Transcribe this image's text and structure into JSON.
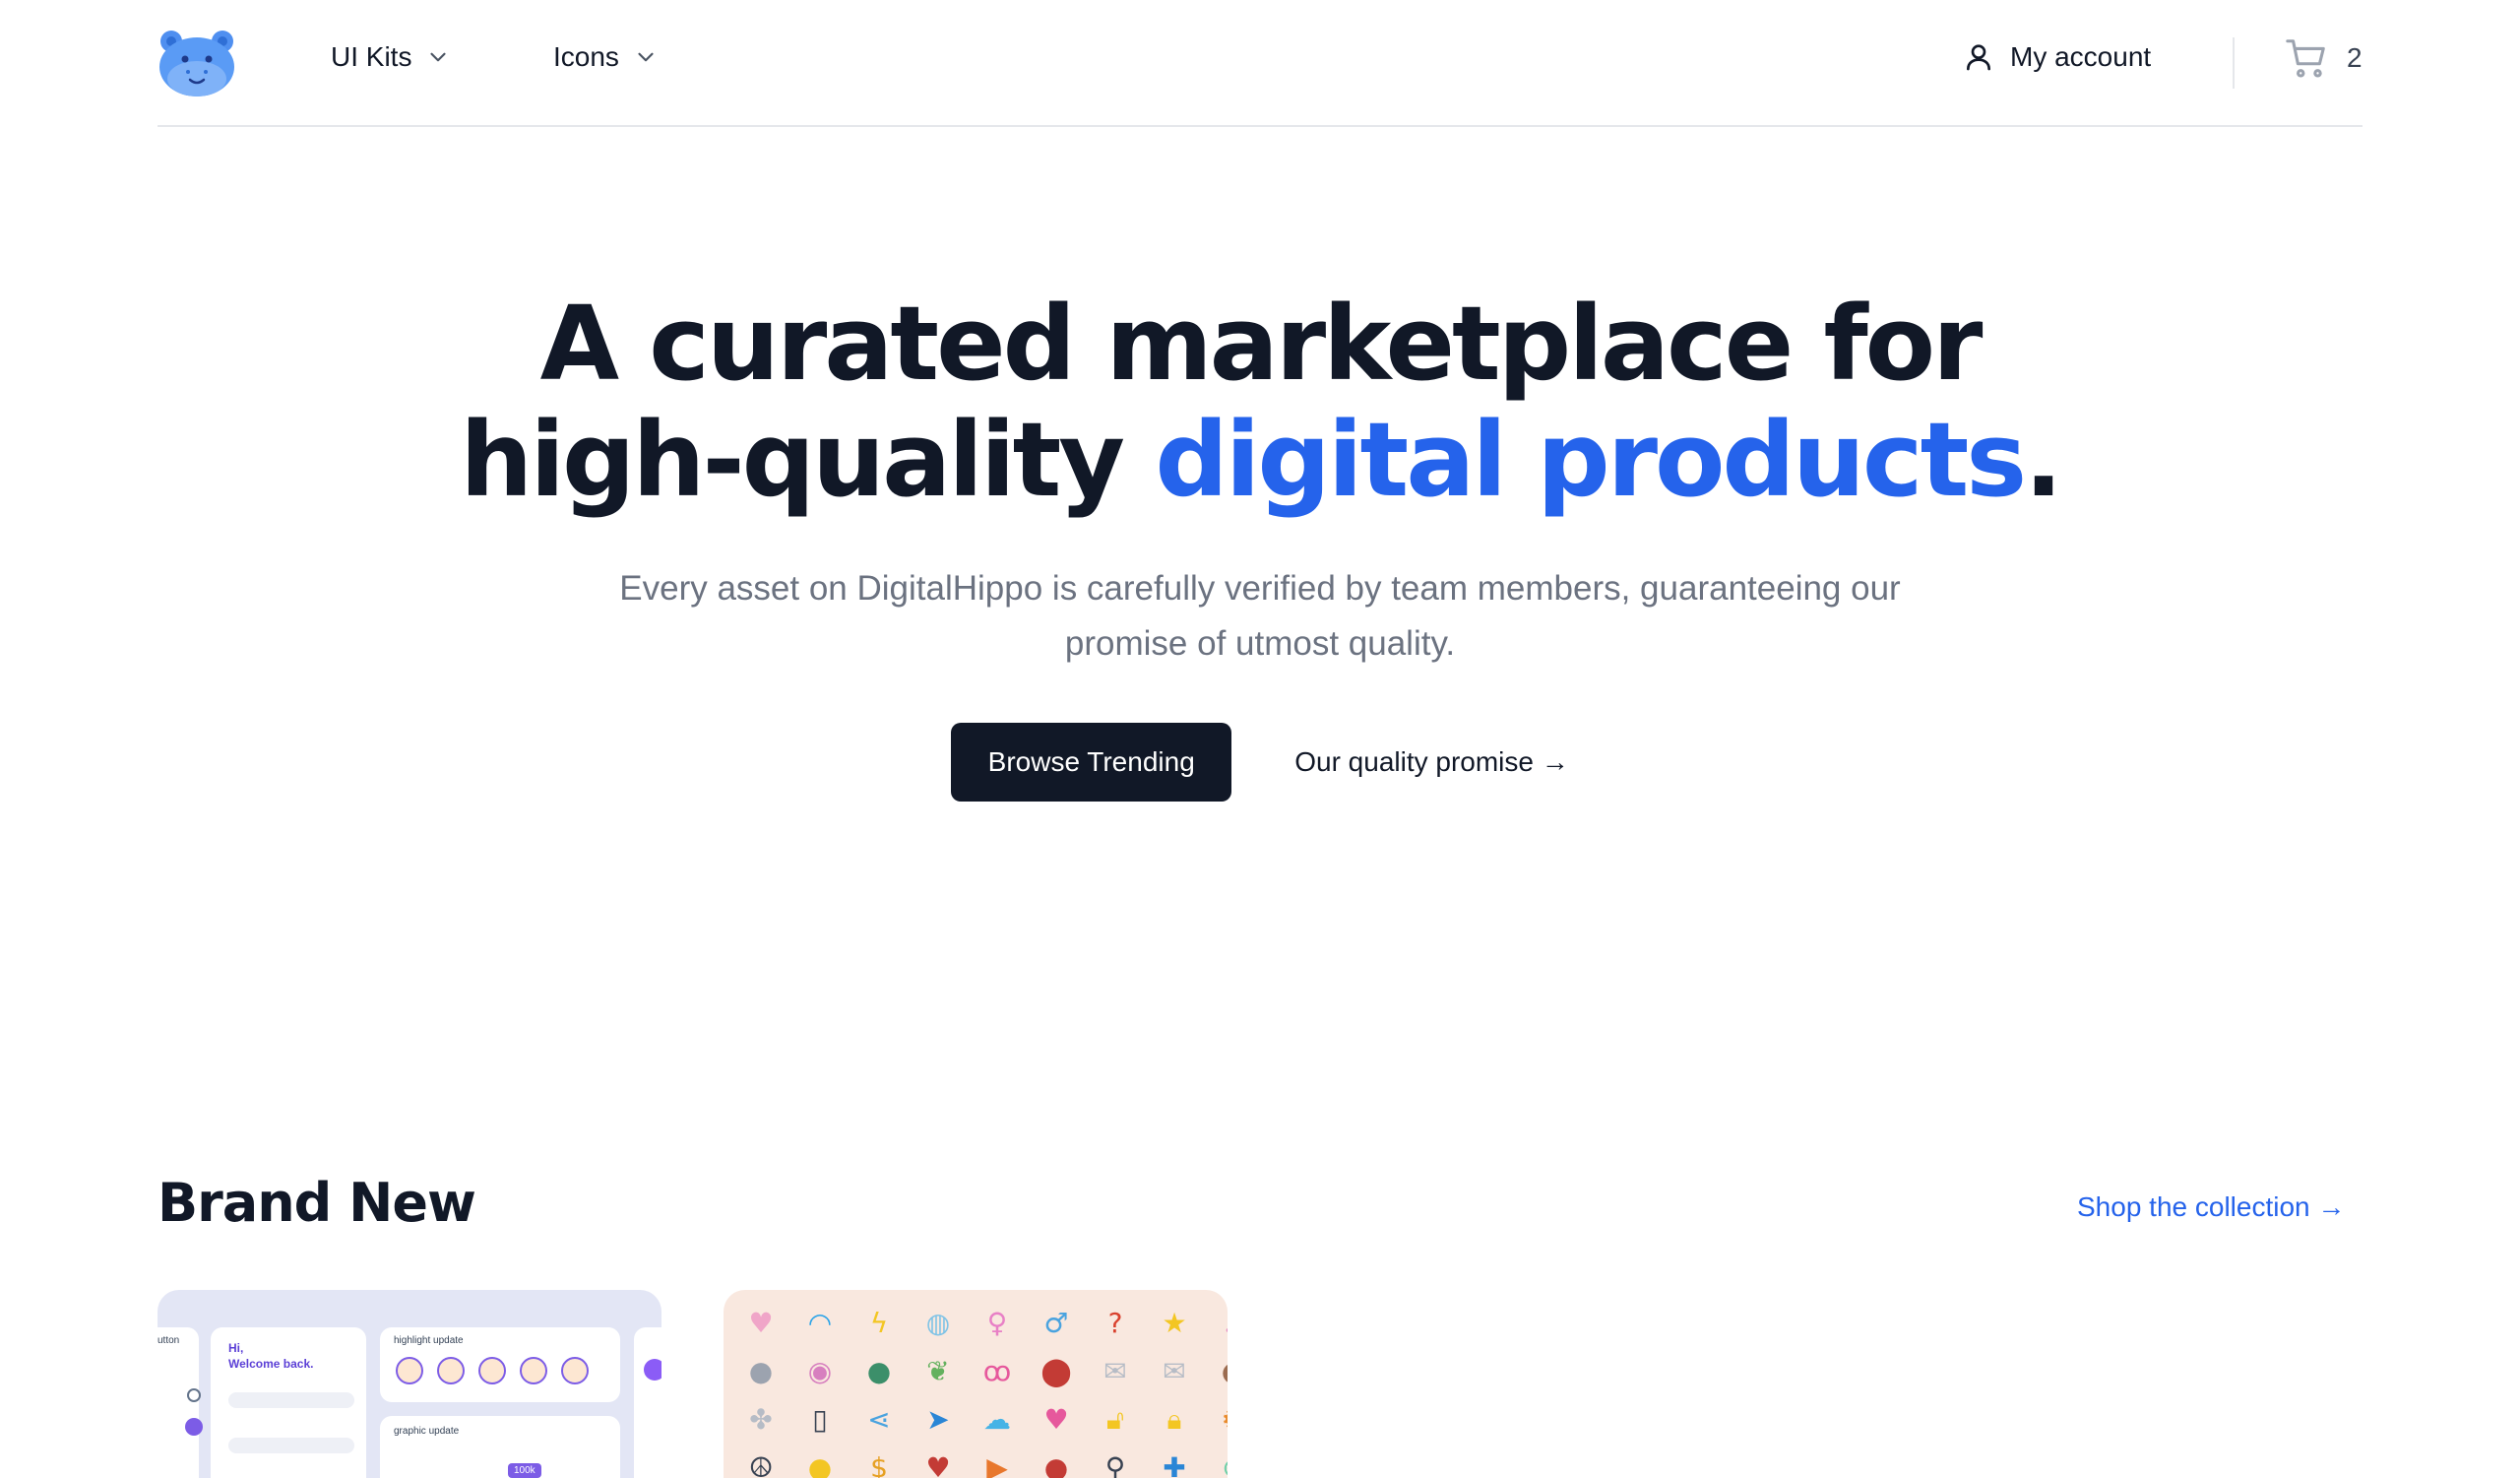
{
  "nav": {
    "items": [
      {
        "label": "UI Kits"
      },
      {
        "label": "Icons"
      }
    ],
    "account_label": "My account",
    "cart_count": "2"
  },
  "hero": {
    "title_part1": "A curated marketplace for",
    "title_part2": "high-quality ",
    "title_accent": "digital products",
    "title_end": ".",
    "subtitle": "Every asset on DigitalHippo is carefully verified by team members, guaranteeing our promise of utmost quality.",
    "primary_cta": "Browse Trending",
    "secondary_cta": "Our quality promise →"
  },
  "brand_new": {
    "title": "Brand New",
    "link": "Shop the collection →",
    "mock": {
      "button_text": "utton",
      "greeting_hi": "Hi,",
      "greeting_welcome": "Welcome back.",
      "highlight_title": "highlight update",
      "graphic_title": "graphic update",
      "chip": "100k"
    }
  },
  "colors": {
    "accent": "#2563eb",
    "dark": "#111827",
    "muted": "#6b7280"
  }
}
